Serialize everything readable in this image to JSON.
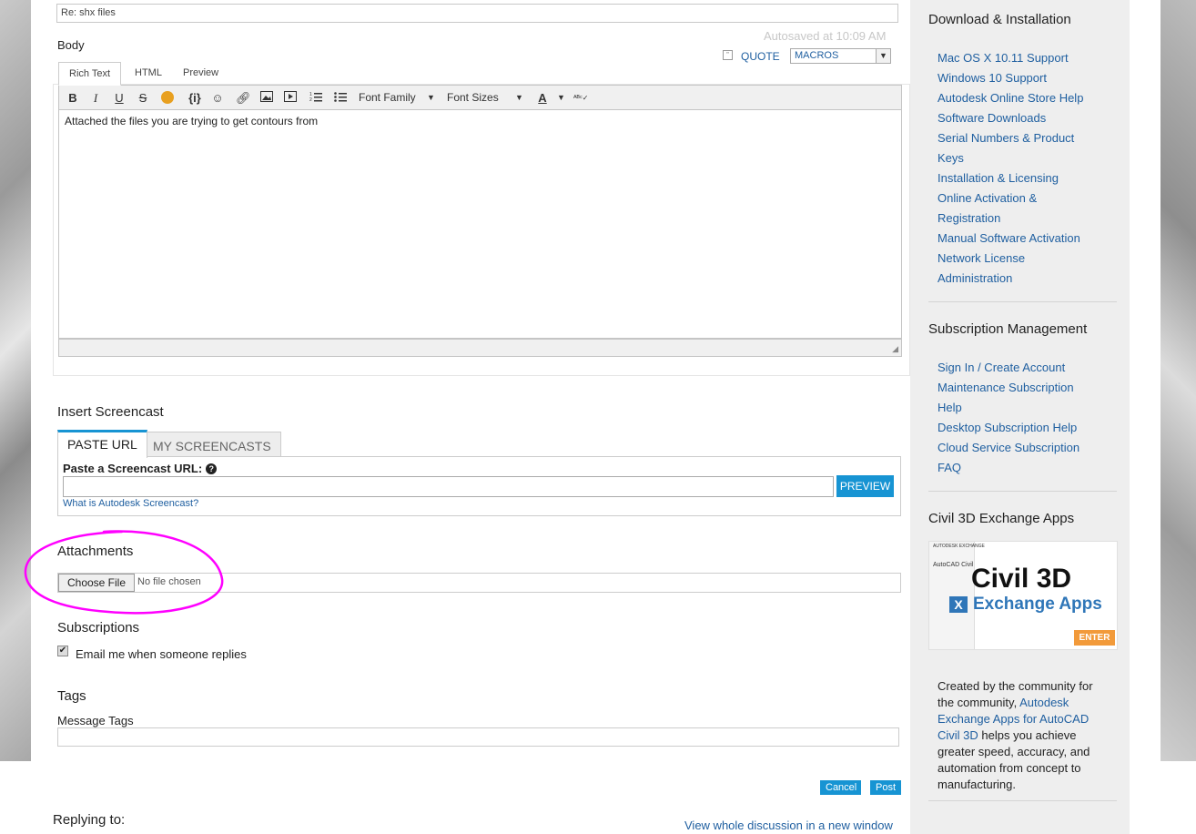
{
  "form": {
    "subject_value": "Re: shx files",
    "body_label": "Body",
    "autosaved": "Autosaved at 10:09 AM",
    "quote_label": "QUOTE",
    "macros_value": "MACROS",
    "editor_tabs": [
      "Rich Text",
      "HTML",
      "Preview"
    ],
    "toolbar": {
      "font_family": "Font Family",
      "font_sizes": "Font Sizes"
    },
    "body_text": "Attached the files you are trying to get contours from"
  },
  "screencast": {
    "title": "Insert Screencast",
    "tabs": [
      "PASTE URL",
      "MY SCREENCASTS"
    ],
    "url_label": "Paste a Screencast URL:",
    "preview_button": "PREVIEW",
    "what_is_link": "What is Autodesk Screencast?"
  },
  "attachments": {
    "title": "Attachments",
    "choose_file": "Choose File",
    "no_file": "No file chosen",
    "highlight_color": "#ff00ff"
  },
  "subscriptions": {
    "title": "Subscriptions",
    "email_label": "Email me when someone replies",
    "email_checked": true
  },
  "tags": {
    "title": "Tags",
    "label": "Message Tags"
  },
  "actions": {
    "cancel": "Cancel",
    "post": "Post"
  },
  "replying": {
    "label": "Replying to:",
    "view_whole": "View whole discussion in a new window"
  },
  "sidebar": {
    "download": {
      "title": "Download & Installation",
      "lines": [
        "Mac OS X 10.11 Support",
        "Windows 10 Support",
        "Autodesk Online Store Help",
        "Software Downloads",
        "Serial Numbers & Product",
        "Keys",
        "Installation & Licensing",
        "Online Activation &",
        "Registration",
        "Manual Software Activation",
        "Network License",
        "Administration"
      ]
    },
    "subscription": {
      "title": "Subscription Management",
      "lines": [
        "Sign In / Create Account",
        "Maintenance Subscription",
        "Help",
        "Desktop Subscription Help",
        "Cloud Service Subscription",
        "FAQ"
      ]
    },
    "apps": {
      "title": "Civil 3D Exchange Apps",
      "promo_header": "AUTODESK EXCHANGE",
      "promo_crumb": "AutoCAD Civil",
      "promo_big": "Civil 3D",
      "promo_sub": "Exchange Apps",
      "promo_enter": "ENTER",
      "text_before": "Created by the community for the community,",
      "text_link": "Autodesk Exchange Apps for AutoCAD Civil 3D",
      "text_after": "helps you achieve greater speed, accuracy, and automation from concept to manufacturing."
    }
  },
  "colors": {
    "accent": "#1794d3",
    "link": "#1f5fa0"
  }
}
